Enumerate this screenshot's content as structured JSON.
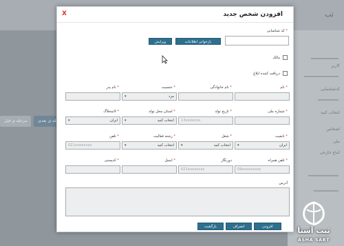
{
  "background": {
    "title_fragment": "ثب",
    "buttons": [
      "مرحله ی قبل",
      "مرحله ی بعدی"
    ],
    "right_panel_texts": [
      "کاربر",
      "کدشناسایی",
      "انتخاب کنید",
      "اشخاص",
      "ملی",
      "اتباع خارجی"
    ]
  },
  "modal": {
    "title": "افزودن شخص جدید",
    "close_label": "X",
    "id_code": {
      "label": "کد شناسایی",
      "value": ""
    },
    "reload_button": "بازخوانی اطلاعات",
    "edit_button": "ویرایش",
    "owner_label": "مالک",
    "notify_label": "دریافت کننده ابلاغ",
    "fields": {
      "first_name": {
        "label": "نام",
        "value": ""
      },
      "last_name": {
        "label": "نام خانوادگی",
        "value": ""
      },
      "gender": {
        "label": "جنسیت",
        "value": "مرد"
      },
      "father_name": {
        "label": "نام پدر",
        "value": ""
      },
      "national_id": {
        "label": "شماره ملی",
        "value": ""
      },
      "birth_date": {
        "label": "تاریخ تولد",
        "placeholder": "13xx/xx/xx"
      },
      "birth_province": {
        "label": "استان محل تولد",
        "value": "انتخاب کنید"
      },
      "city": {
        "label": "لاتمحلاگ",
        "value": "ایران"
      },
      "nationality": {
        "label": "تابعیت",
        "value": "ایران"
      },
      "job": {
        "label": "شغل",
        "value": "انتخاب کنید"
      },
      "activity_field": {
        "label": "رشته فعالیت",
        "value": "انتخاب کنید"
      },
      "phone": {
        "label": "تلفن",
        "placeholder": "021xxxxxxxx"
      },
      "mobile": {
        "label": "تلفن همراه",
        "placeholder": "09xxxxxxxxx"
      },
      "fax": {
        "label": "دورنگار",
        "placeholder": "021xxxxxxxx"
      },
      "email": {
        "label": "ایمیل",
        "value": ""
      },
      "postal_code": {
        "label": "کدپستی",
        "value": ""
      },
      "address": {
        "label": "آدرس",
        "value": ""
      }
    },
    "footer": {
      "add_button": "افزودن",
      "cancel_button": "انصراف",
      "back_button": "بازگشت"
    }
  },
  "logo": {
    "text_fa": "ثبت آسنا",
    "text_en": "ASHA SABT"
  },
  "colors": {
    "accent": "#2e6f8e",
    "required": "#d9322e",
    "overlay": "#8f969c"
  }
}
